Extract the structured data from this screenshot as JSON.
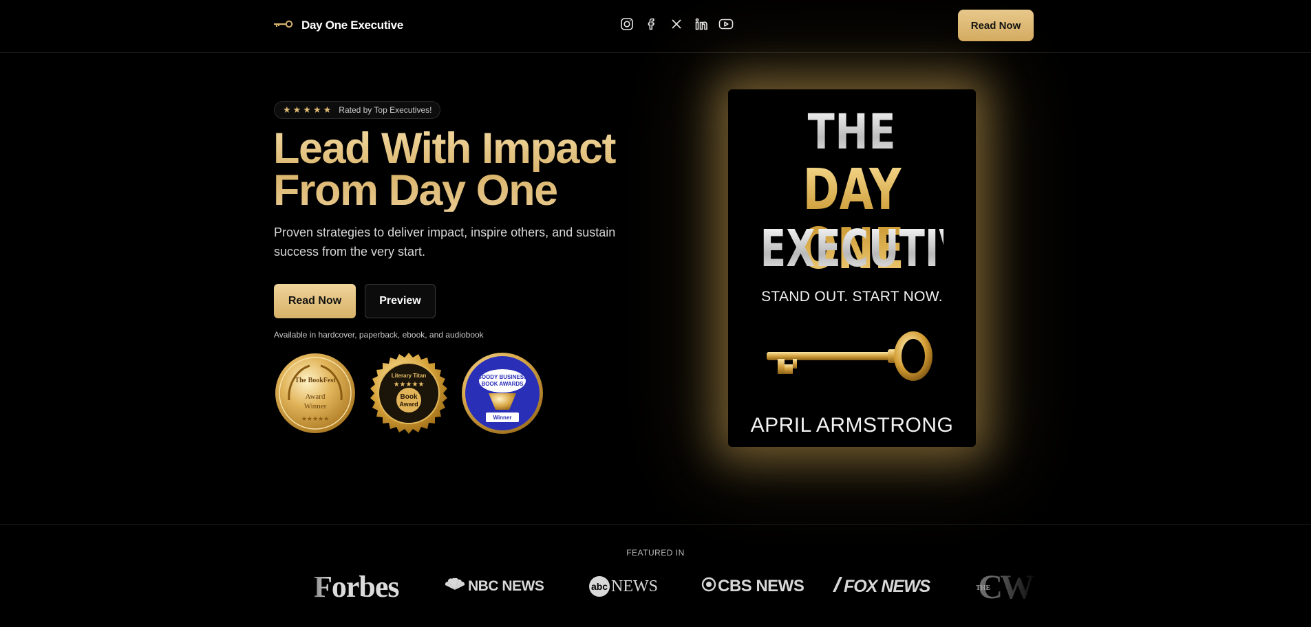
{
  "nav": {
    "brand_name": "Day One Executive",
    "brand_icon": "key-icon",
    "socials": [
      {
        "name": "instagram-icon"
      },
      {
        "name": "facebook-icon"
      },
      {
        "name": "x-icon"
      },
      {
        "name": "linkedin-icon"
      },
      {
        "name": "youtube-icon"
      }
    ],
    "cta_label": "Read Now"
  },
  "hero": {
    "rating_stars": "★★★★★",
    "rating_text": "Rated by Top Executives!",
    "headline_line1": "Lead With Impact",
    "headline_line2": "From Day One",
    "subtitle": "Proven strategies to deliver impact, inspire others, and sustain success from the very start.",
    "primary_button": "Read Now",
    "secondary_button": "Preview",
    "availability": "Available in hardcover, paperback, ebook, and audiobook",
    "badges": [
      {
        "title": "The BookFest",
        "line2": "Award",
        "line3": "Winner"
      },
      {
        "title": "Literary Titan",
        "line2": "Book",
        "line3": "Award"
      },
      {
        "title": "Goody Business Book Awards",
        "line2": "Winner"
      }
    ]
  },
  "book": {
    "line1": "THE",
    "line2": "DAY ONE",
    "line3": "EXECUTIVE",
    "tagline": "STAND OUT. START NOW.",
    "author": "APRIL ARMSTRONG"
  },
  "featured": {
    "label": "FEATURED IN",
    "logos": [
      "Forbes",
      "NBC NEWS",
      "NEWS",
      "CBS NEWS",
      "FOX NEWS",
      "CW"
    ],
    "abc_mark": "abc",
    "cw_mark": "THE"
  },
  "colors": {
    "gold": "#e1bc76",
    "gold_dark": "#c9962f",
    "background": "#000000",
    "goody_blue": "#2a2fb8"
  }
}
